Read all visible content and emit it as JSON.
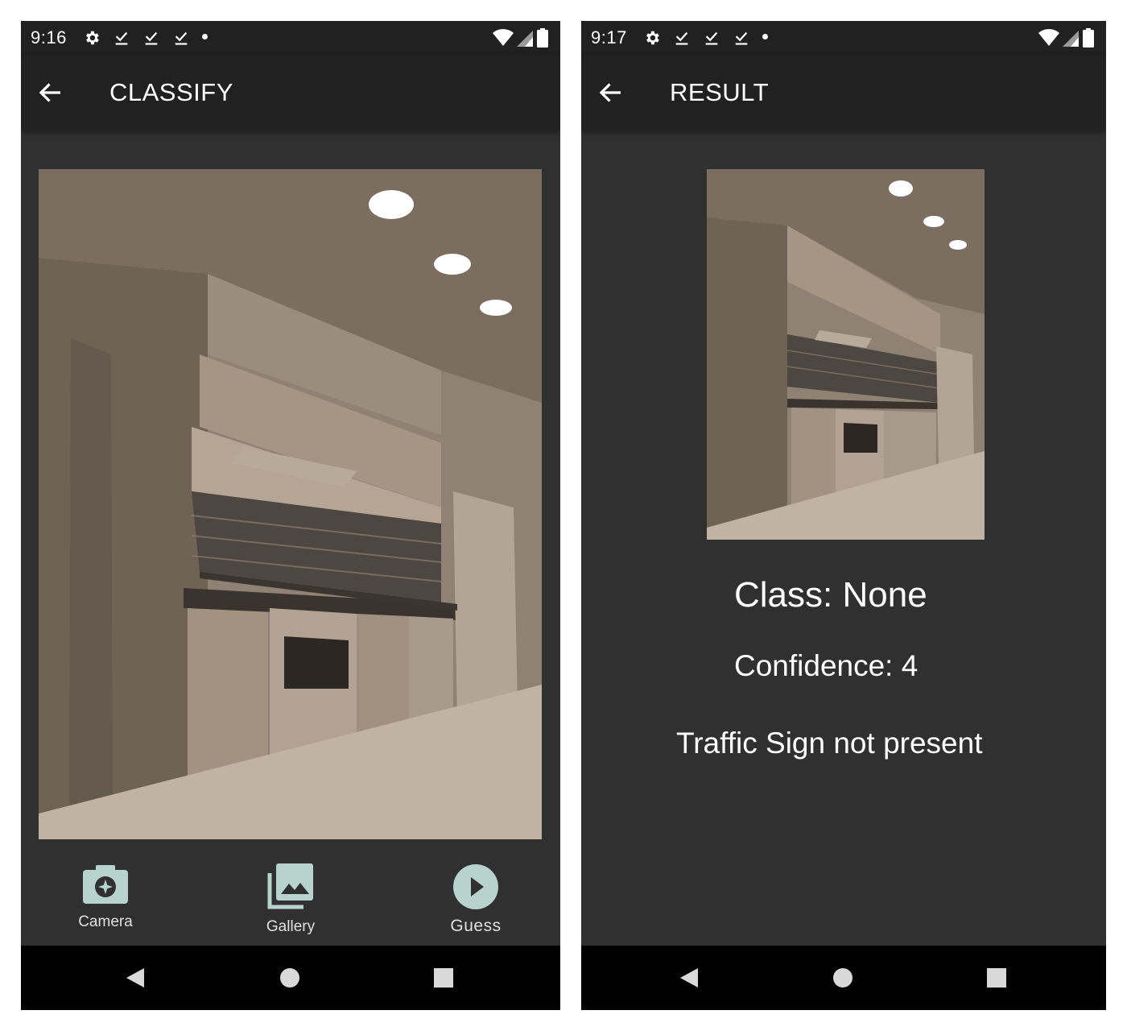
{
  "colors": {
    "surface": "#303030",
    "app_bar": "#212121",
    "nav_bar": "#000000",
    "accent": "#b7d3cc",
    "text": "#ffffff"
  },
  "left_screen": {
    "status_bar": {
      "time": "9:16",
      "icons": [
        "settings-icon",
        "download-done-icon",
        "download-done-icon",
        "download-done-icon",
        "notification-dot-icon"
      ],
      "right_icons": [
        "wifi-icon",
        "cell-signal-icon",
        "battery-icon"
      ]
    },
    "app_bar": {
      "title": "CLASSIFY",
      "nav_icon": "back-arrow-icon"
    },
    "image": {
      "icon": "kitchen-photo"
    },
    "actions": [
      {
        "label": "Camera",
        "icon": "camera-icon"
      },
      {
        "label": "Gallery",
        "icon": "gallery-icon"
      },
      {
        "label": "Guess",
        "icon": "play-circle-icon"
      }
    ],
    "nav_bar": [
      "back-triangle-icon",
      "home-circle-icon",
      "recents-square-icon"
    ]
  },
  "right_screen": {
    "status_bar": {
      "time": "9:17",
      "icons": [
        "settings-icon",
        "download-done-icon",
        "download-done-icon",
        "download-done-icon",
        "notification-dot-icon"
      ],
      "right_icons": [
        "wifi-icon",
        "cell-signal-icon",
        "battery-icon"
      ]
    },
    "app_bar": {
      "title": "RESULT",
      "nav_icon": "back-arrow-icon"
    },
    "image": {
      "icon": "kitchen-photo"
    },
    "result": {
      "class_text": "Class: None",
      "confidence_text": "Confidence: 4",
      "message": "Traffic Sign not present"
    },
    "nav_bar": [
      "back-triangle-icon",
      "home-circle-icon",
      "recents-square-icon"
    ]
  }
}
